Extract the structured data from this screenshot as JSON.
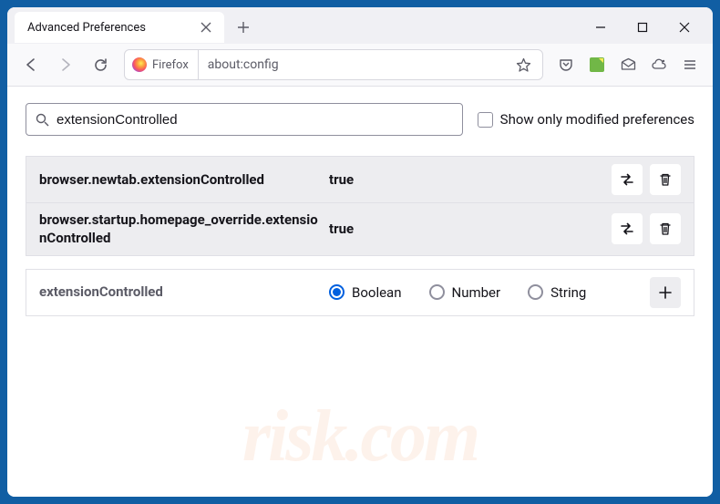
{
  "tab": {
    "title": "Advanced Preferences"
  },
  "urlbar": {
    "identity_label": "Firefox",
    "url": "about:config"
  },
  "search": {
    "value": "extensionControlled",
    "show_modified_label": "Show only modified preferences"
  },
  "prefs": [
    {
      "name": "browser.newtab.extensionControlled",
      "value": "true"
    },
    {
      "name": "browser.startup.homepage_override.extensionControlled",
      "value": "true"
    }
  ],
  "new_pref": {
    "name": "extensionControlled",
    "types": [
      {
        "label": "Boolean",
        "selected": true
      },
      {
        "label": "Number",
        "selected": false
      },
      {
        "label": "String",
        "selected": false
      }
    ]
  },
  "watermark": "risk.com"
}
